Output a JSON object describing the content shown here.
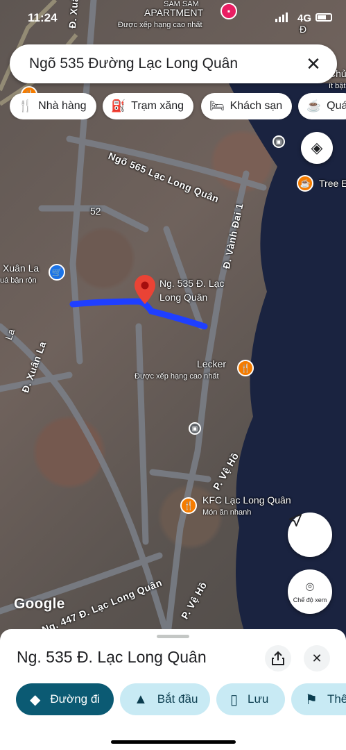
{
  "status_bar": {
    "time": "11:24",
    "network": "4G"
  },
  "search": {
    "query": "Ngõ 535 Đường Lạc Long Quân",
    "clear_icon": "close-icon"
  },
  "chips": [
    {
      "label": "Nhà hàng",
      "icon": "restaurant-icon"
    },
    {
      "label": "Trạm xăng",
      "icon": "gas-station-icon"
    },
    {
      "label": "Khách sạn",
      "icon": "hotel-icon"
    },
    {
      "label": "Quá",
      "icon": "coffee-icon"
    }
  ],
  "map": {
    "labels": {
      "apartment_top": "SAM SAM",
      "apartment": "APARTMENT",
      "apartment_sub": "Được xếp hạng cao nhất",
      "road_565": "Ngõ 565 Lạc Long Quân",
      "num_52": "52",
      "vanh_dai": "Đ. Vành Đai 1",
      "xuan_la_store": "Xuân La",
      "xuan_la_store_sub": "uá bận rộn",
      "xuan_la_road": "Đ. Xuân La",
      "xuan_la_top": "Đ. Xuân La",
      "la": "La",
      "pin_label_1": "Ng. 535 Đ. Lạc",
      "pin_label_2": "Long Quân",
      "lecker": "Lecker",
      "lecker_sub": "Được xếp hạng cao nhất",
      "ve_ho_1": "P. Vệ Hồ",
      "ve_ho_2": "P. Vệ Hồ",
      "kfc": "KFC Lạc Long Quân",
      "kfc_sub": "Món ăn nhanh",
      "ng447": "Ng. 447 Đ. Lạc Long Quân",
      "tree": "Tree E",
      "chu": "Chủ",
      "it_bat": "ít bật",
      "right_top": "Đ"
    },
    "google_logo": "Google",
    "layers_icon": "layers-icon",
    "locate_icon": "navigation-arrow-icon",
    "camera_label": "Chế độ xem"
  },
  "place": {
    "title": "Ng. 535 Đ. Lạc Long Quân",
    "share_icon": "share-icon",
    "close_icon": "close-icon"
  },
  "actions": [
    {
      "label": "Đường đi",
      "icon": "directions-icon"
    },
    {
      "label": "Bắt đầu",
      "icon": "navigation-icon"
    },
    {
      "label": "Lưu",
      "icon": "bookmark-icon"
    },
    {
      "label": "Thê",
      "icon": "flag-icon"
    }
  ],
  "colors": {
    "route": "#1f3fff",
    "pin": "#ea4335",
    "primary_action": "#0b5a73",
    "secondary_action": "#c8eaf4",
    "lake": "#1a2340"
  }
}
